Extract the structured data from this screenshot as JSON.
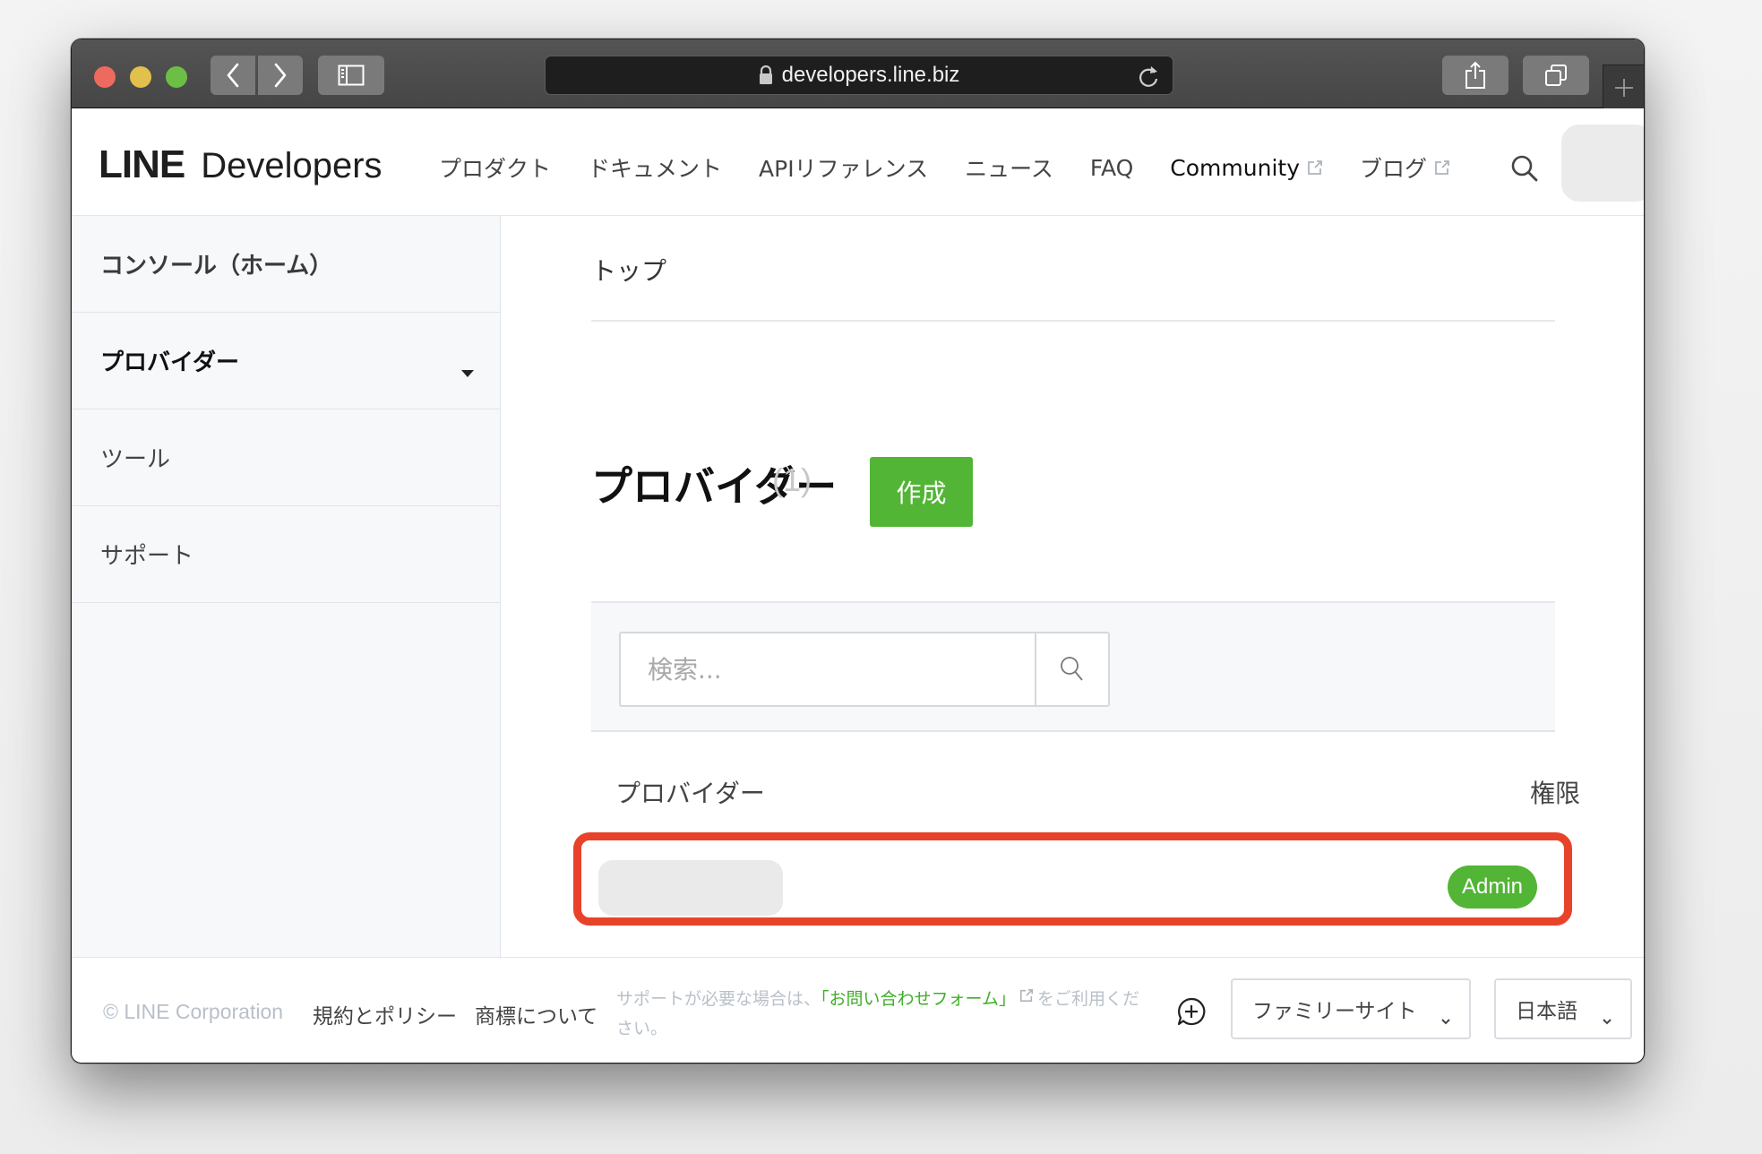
{
  "browser": {
    "url": "developers.line.biz",
    "buttons": {
      "back": "back-icon",
      "forward": "forward-icon",
      "sidebar": "sidebar-icon",
      "share": "share-icon",
      "tabs": "tabs-overview-icon",
      "new_tab": "plus-icon",
      "reload": "reload-icon"
    }
  },
  "header": {
    "logo_line": "LINE",
    "logo_developers": "Developers",
    "nav": [
      {
        "label": "プロダクト",
        "external": false
      },
      {
        "label": "ドキュメント",
        "external": false
      },
      {
        "label": "APIリファレンス",
        "external": false
      },
      {
        "label": "ニュース",
        "external": false
      },
      {
        "label": "FAQ",
        "external": false
      },
      {
        "label": "Community",
        "external": true
      },
      {
        "label": "ブログ",
        "external": true
      }
    ]
  },
  "sidebar": {
    "items": [
      {
        "label": "コンソール（ホーム）"
      },
      {
        "label": "プロバイダー",
        "active": true,
        "expandable": true
      },
      {
        "label": "ツール"
      },
      {
        "label": "サポート"
      }
    ]
  },
  "main": {
    "breadcrumb": "トップ",
    "title": "プロバイダー",
    "count": "(1)",
    "create_label": "作成",
    "search_placeholder": "検索...",
    "columns": {
      "provider": "プロバイダー",
      "permission": "権限"
    },
    "rows": [
      {
        "name": "",
        "permission": "Admin"
      }
    ]
  },
  "footer": {
    "copyright": "© LINE Corporation",
    "terms": "規約とポリシー",
    "trademark": "商標について",
    "support_prefix": "サポートが必要な場合は、",
    "support_link": "「お問い合わせフォーム」",
    "support_suffix": "をご利用ください。",
    "family_site": "ファミリーサイト",
    "language": "日本語"
  },
  "colors": {
    "brand_green": "#52b535",
    "highlight_red": "#e8432a",
    "link_green": "#3fae29"
  }
}
